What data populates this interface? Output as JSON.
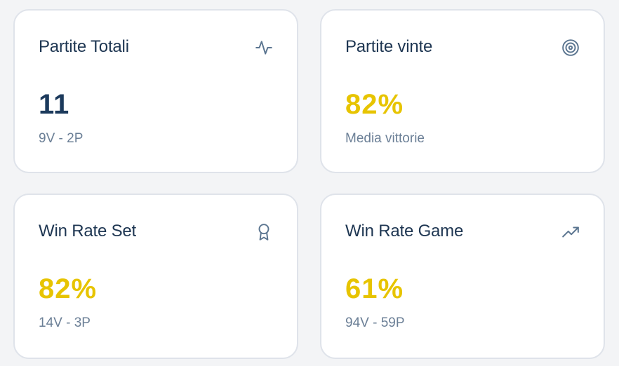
{
  "cards": [
    {
      "title": "Partite Totali",
      "value": "11",
      "sub": "9V - 2P",
      "icon": "activity-icon",
      "value_color": "#1c3a5c"
    },
    {
      "title": "Partite vinte",
      "value": "82%",
      "sub": "Media vittorie",
      "icon": "target-icon",
      "value_color": "#e7c400"
    },
    {
      "title": "Win Rate Set",
      "value": "82%",
      "sub": "14V - 3P",
      "icon": "award-icon",
      "value_color": "#e7c400"
    },
    {
      "title": "Win Rate Game",
      "value": "61%",
      "sub": "94V - 59P",
      "icon": "trending-up-icon",
      "value_color": "#e7c400"
    }
  ]
}
